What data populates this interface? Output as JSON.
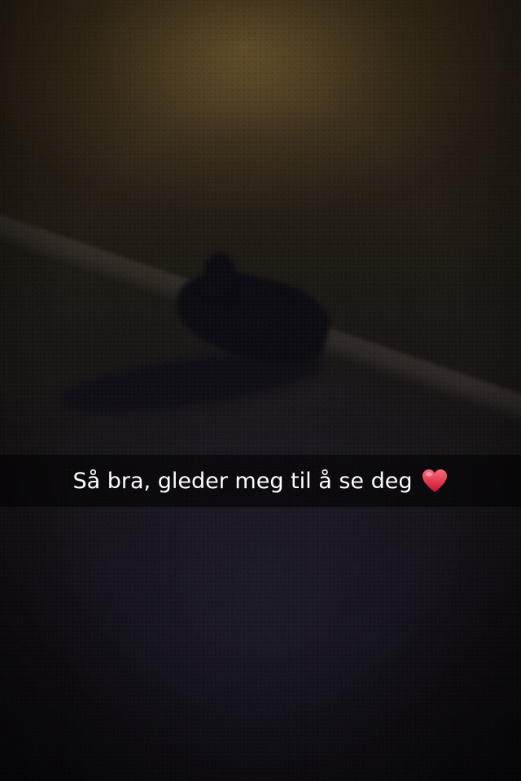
{
  "caption": {
    "text": "Så bra, gleder meg til å se deg",
    "emoji": "heart-icon",
    "emoji_color": "#e0263a"
  },
  "scene": {
    "background_colors": [
      "#3a2f1c",
      "#1d1914",
      "#0e0c10"
    ]
  }
}
